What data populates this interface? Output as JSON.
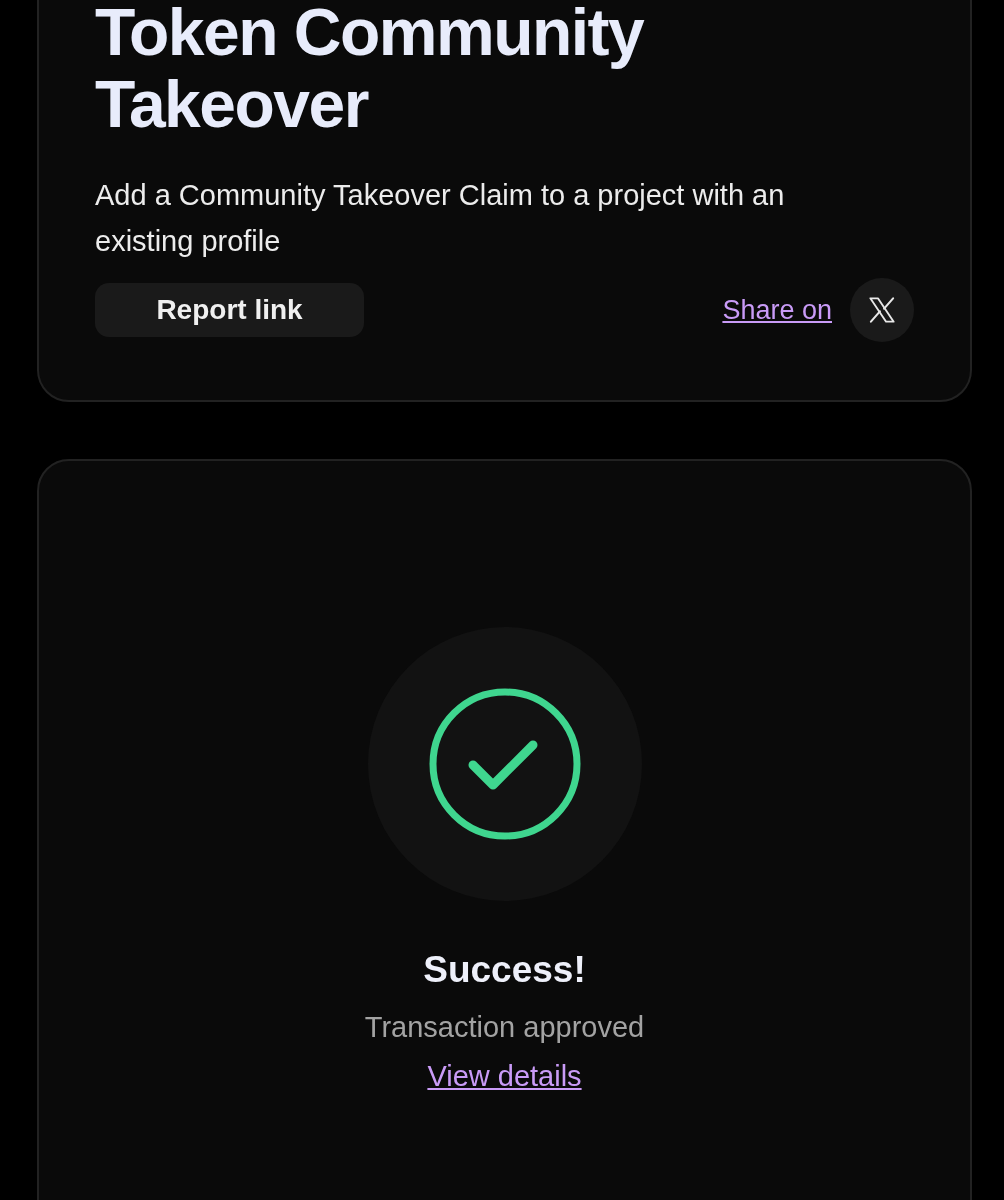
{
  "claim_card": {
    "title": "Token Community Takeover",
    "description": "Add a Community Takeover Claim to a project with an existing profile",
    "report_button": "Report link",
    "share_link": "Share on"
  },
  "result_card": {
    "kind": "success",
    "title": "Success!",
    "message": "Transaction approved",
    "details_link": "View details"
  }
}
